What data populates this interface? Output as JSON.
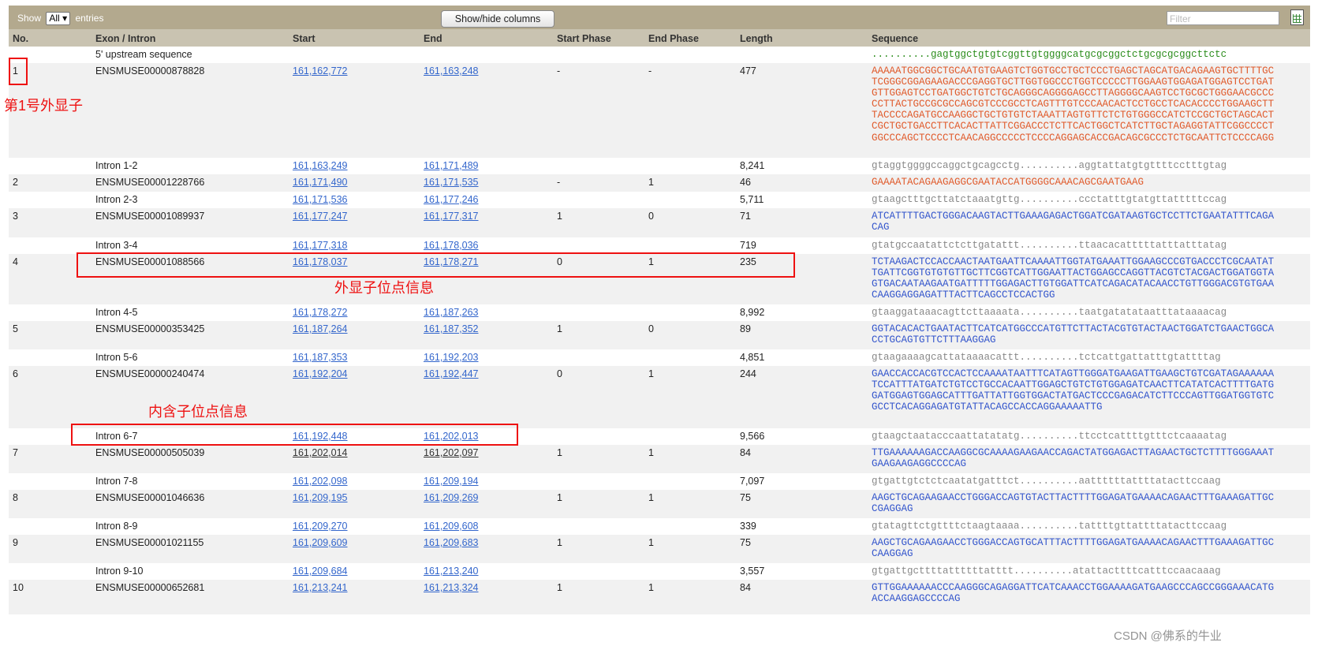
{
  "toolbar": {
    "show": "Show",
    "select_value": "All",
    "entries": "entries",
    "toggle_columns": "Show/hide columns",
    "filter_placeholder": "Filter",
    "export_icon": "excel-icon"
  },
  "columns": [
    "No.",
    "Exon / Intron",
    "Start",
    "End",
    "Start Phase",
    "End Phase",
    "Length",
    "Sequence"
  ],
  "rows": [
    {
      "no": "",
      "name": "5' upstream sequence",
      "start": "",
      "end": "",
      "sp": "",
      "ep": "",
      "len": "",
      "seq": "..........gagtggctgtgtcggttgtggggcatgcgcggctctgcgcgcggcttctc"
    },
    {
      "no": "1",
      "name": "ENSMUSE00000878828",
      "start": "161,162,772",
      "end": "161,163,248",
      "sp": "-",
      "ep": "-",
      "len": "477",
      "seq": "AAAAATGGCGGCTGCAATGTGAAGTCTGGTGCCTGCTCCCTGAGCTAGCATGACAGAAGTGCTTTTGCTCGGGCGGAGAAGACCCGAGGTGCTTGGTGGCCCTGGTCCCCCTTGGAAGTGGAGATGGAGTCCTGATGTTGGAGTCCTGATGGCTGTCTGCAGGGCAGGGGAGCCTTAGGGGCAAGTCCTGCGCTGGGAACGCCCCCTTACTGCCGCGCCAGCGTCCCGCCTCAGTTTGTCCCAACACTCCTGCCTCACACCCCTGGAAGCTTTACCCCAGATGCCAAGGCTGCTGTGTCTAAATTAGTGTTCTCTGTGGGCCATCTCCGCTGCTAGCACTCGCTGCTGACCTTCACACTTATTCGGACCCTCTTCACTGGCTCATCTTGCTAGAGGTATTCGGCCCCTGGCCCAGCTCCCCTCAACAGGCCCCCTCCCCAGGAGCACCGACAGCGCCCTCTGCAATTCTCCCCAGG"
    },
    {
      "no": "",
      "name": "Intron 1-2",
      "start": "161,163,249",
      "end": "161,171,489",
      "sp": "",
      "ep": "",
      "len": "8,241",
      "seq": "gtaggtggggccaggctgcagcctg..........aggtattatgtgttttcctttgtag"
    },
    {
      "no": "2",
      "name": "ENSMUSE00001228766",
      "start": "161,171,490",
      "end": "161,171,535",
      "sp": "-",
      "ep": "1",
      "len": "46",
      "seq": "GAAAATACAGAAGAGGCGAATACCATGGGGCAAACAGCGAATGAAG"
    },
    {
      "no": "",
      "name": "Intron 2-3",
      "start": "161,171,536",
      "end": "161,177,246",
      "sp": "",
      "ep": "",
      "len": "5,711",
      "seq": "gtaagctttgcttatctaaatgttg..........ccctatttgtatgttatttttccag"
    },
    {
      "no": "3",
      "name": "ENSMUSE00001089937",
      "start": "161,177,247",
      "end": "161,177,317",
      "sp": "1",
      "ep": "0",
      "len": "71",
      "seq": "ATCATTTTGACTGGGACAAGTACTTGAAAGAGACTGGATCGATAAGTGCTCCTTCTGAATATTTCAGACAG"
    },
    {
      "no": "",
      "name": "Intron 3-4",
      "start": "161,177,318",
      "end": "161,178,036",
      "sp": "",
      "ep": "",
      "len": "719",
      "seq": "gtatgccaatattctcttgatattt..........ttaacacatttttatttatttatag"
    },
    {
      "no": "4",
      "name": "ENSMUSE00001088566",
      "start": "161,178,037",
      "end": "161,178,271",
      "sp": "0",
      "ep": "1",
      "len": "235",
      "seq": "TCTAAGACTCCACCAACTAATGAATTCAAAATTGGTATGAAATTGGAAGCCCGTGACCCTCGCAATATTGATTCGGTGTGTGTTGCTTCGGTCATTGGAATTACTGGAGCCAGGTTACGTCTACGACTGGATGGTAGTGACAATAAGAATGATTTTTGGAGACTTGTGGATTCATCAGACATACAACCTGTTGGGACGTGTGAACAAGGAGGAGATTTACTTCAGCCTCCACTGG"
    },
    {
      "no": "",
      "name": "Intron 4-5",
      "start": "161,178,272",
      "end": "161,187,263",
      "sp": "",
      "ep": "",
      "len": "8,992",
      "seq": "gtaaggataaacagttcttaaaata..........taatgatatataatttataaaacag"
    },
    {
      "no": "5",
      "name": "ENSMUSE00000353425",
      "start": "161,187,264",
      "end": "161,187,352",
      "sp": "1",
      "ep": "0",
      "len": "89",
      "seq": "GGTACACACTGAATACTTCATCATGGCCCATGTTCTTACTACGTGTACTAACTGGATCTGAACTGGCACCTGCAGTGTTCTTTAAGGAG"
    },
    {
      "no": "",
      "name": "Intron 5-6",
      "start": "161,187,353",
      "end": "161,192,203",
      "sp": "",
      "ep": "",
      "len": "4,851",
      "seq": "gtaagaaaagcattataaaacattt..........tctcattgattatttgtattttag"
    },
    {
      "no": "6",
      "name": "ENSMUSE00000240474",
      "start": "161,192,204",
      "end": "161,192,447",
      "sp": "0",
      "ep": "1",
      "len": "244",
      "seq": "GAACCACCACGTCCACTCCAAAATAATTTCATAGTTGGGATGAAGATTGAAGCTGTCGATAGAAAAAATCCATTTATGATCTGTCCTGCCACAATTGGAGCTGTCTGTGGAGATCAACTTCATATCACTTTTGATGGATGGAGTGGAGCATTTGATTATTGGTGGACTATGACTCCCGAGACATCTTCCCAGTTGGATGGTGTCGCCTCACAGGAGATGTATTACAGCCACCAGGAAAAATTG"
    },
    {
      "no": "",
      "name": "Intron 6-7",
      "start": "161,192,448",
      "end": "161,202,013",
      "sp": "",
      "ep": "",
      "len": "9,566",
      "seq": "gtaagctaatacccaattatatatg..........ttcctcattttgtttctcaaaatag"
    },
    {
      "no": "7",
      "name": "ENSMUSE00000505039",
      "start": "161,202,014",
      "end": "161,202,097",
      "sp": "1",
      "ep": "1",
      "len": "84",
      "seq": "TTGAAAAAAGACCAAGGCGCAAAAGAAGAACCAGACTATGGAGACTTAGAACTGCTCTTTTGGGAAATGAAGAAGAGGCCCCAG"
    },
    {
      "no": "",
      "name": "Intron 7-8",
      "start": "161,202,098",
      "end": "161,209,194",
      "sp": "",
      "ep": "",
      "len": "7,097",
      "seq": "gtgattgtctctcaatatgatttct..........aattttttattttatacttccaag"
    },
    {
      "no": "8",
      "name": "ENSMUSE00001046636",
      "start": "161,209,195",
      "end": "161,209,269",
      "sp": "1",
      "ep": "1",
      "len": "75",
      "seq": "AAGCTGCAGAAGAACCTGGGACCAGTGTACTTACTTTTGGAGATGAAAACAGAACTTTGAAAGATTGCCGAGGAG"
    },
    {
      "no": "",
      "name": "Intron 8-9",
      "start": "161,209,270",
      "end": "161,209,608",
      "sp": "",
      "ep": "",
      "len": "339",
      "seq": "gtatagttctgttttctaagtaaaa..........tattttgttattttatacttccaag"
    },
    {
      "no": "9",
      "name": "ENSMUSE00001021155",
      "start": "161,209,609",
      "end": "161,209,683",
      "sp": "1",
      "ep": "1",
      "len": "75",
      "seq": "AAGCTGCAGAAGAACCTGGGACCAGTGCATTTACTTTTGGAGATGAAAACAGAACTTTGAAAGATTGCCAAGGAG"
    },
    {
      "no": "",
      "name": "Intron 9-10",
      "start": "161,209,684",
      "end": "161,213,240",
      "sp": "",
      "ep": "",
      "len": "3,557",
      "seq": "gtgattgcttttattttttatttt..........atattacttttcatttccaacaaag"
    },
    {
      "no": "10",
      "name": "ENSMUSE00000652681",
      "start": "161,213,241",
      "end": "161,213,324",
      "sp": "1",
      "ep": "1",
      "len": "84",
      "seq": "GTTGGAAAAAACCCAAGGGCAGAGGATTCATCAAACCTGGAAAAGATGAAGCCCAGCCGGGAAACATGACCAAGGAGCCCCAG"
    }
  ],
  "annotations": {
    "exon1": "第1号外显子",
    "exon_pos": "外显子位点信息",
    "intron_pos": "内含子位点信息"
  },
  "watermark": "CSDN @佛系的牛业"
}
